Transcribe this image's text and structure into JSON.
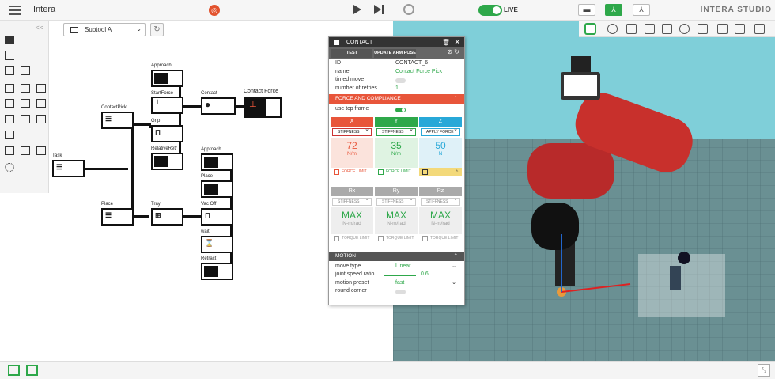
{
  "topbar": {
    "app_name": "Intera",
    "live_label": "LIVE",
    "brand": "INTERA STUDIO"
  },
  "subtool": {
    "selected": "Subtool A"
  },
  "flow_nodes": {
    "approach_top": "Approach",
    "start_force": "StartForce",
    "contact_pick": "ContactPick",
    "grip": "Grip",
    "relative_retr": "RelativeRetr",
    "contact": "Contact",
    "contact_force": "Contact Force",
    "task": "Task",
    "place": "Place",
    "tray": "Tray",
    "approach_mid": "Approach",
    "place_mid": "Place",
    "vac_off": "Vac Off",
    "wait": "wait",
    "retract": "Retract"
  },
  "panel": {
    "title": "CONTACT",
    "test_button": "TEST",
    "update_button": "UPDATE ARM POSE",
    "props": {
      "id_key": "ID",
      "id_val": "CONTACT_6",
      "name_key": "name",
      "name_val": "Contact Force Pick",
      "timed_move_key": "timed move",
      "retries_key": "number of retries",
      "retries_val": "1"
    },
    "force_section": "FORCE AND COMPLIANCE",
    "use_tcp_key": "use tcp frame",
    "axes": [
      {
        "name": "X",
        "mode": "STIFFNESS",
        "value": "72",
        "unit": "N/m",
        "limit": "FORCE LIMIT",
        "color": "#e8553a",
        "slider": 0.55
      },
      {
        "name": "Y",
        "mode": "STIFFNESS",
        "value": "35",
        "unit": "N/m",
        "limit": "FORCE LIMIT",
        "color": "#2ea84a",
        "slider": 0.25
      },
      {
        "name": "Z",
        "mode": "APPLY FORCE",
        "value": "50",
        "unit": "N",
        "limit": "",
        "color": "#28a8d8",
        "slider": 0.35
      }
    ],
    "raxes": [
      {
        "name": "Rx",
        "mode": "STIFFNESS",
        "value": "MAX",
        "unit": "N-m/rad",
        "limit": "TORQUE LIMIT"
      },
      {
        "name": "Ry",
        "mode": "STIFFNESS",
        "value": "MAX",
        "unit": "N-m/rad",
        "limit": "TORQUE LIMIT"
      },
      {
        "name": "Rz",
        "mode": "STIFFNESS",
        "value": "MAX",
        "unit": "N-m/rad",
        "limit": "TORQUE LIMIT"
      }
    ],
    "motion_section": "MOTION",
    "motion": {
      "move_type_key": "move type",
      "move_type_val": "Linear",
      "joint_speed_key": "joint speed ratio",
      "joint_speed_val": "0.6",
      "motion_preset_key": "motion preset",
      "motion_preset_val": "fast",
      "round_corner_key": "round corner"
    }
  }
}
